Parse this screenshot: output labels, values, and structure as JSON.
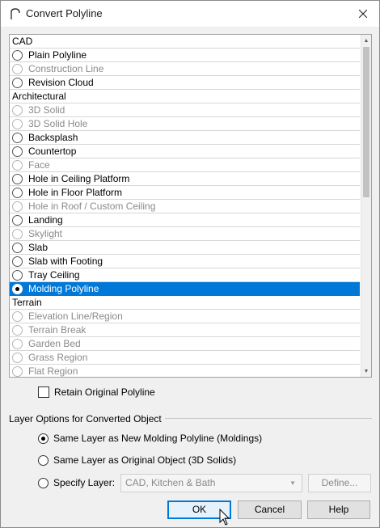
{
  "window": {
    "title": "Convert Polyline"
  },
  "list": {
    "rows": [
      {
        "type": "header",
        "label": "CAD"
      },
      {
        "type": "item",
        "label": "Plain Polyline",
        "enabled": true,
        "selected": false
      },
      {
        "type": "item",
        "label": "Construction Line",
        "enabled": false,
        "selected": false
      },
      {
        "type": "item",
        "label": "Revision Cloud",
        "enabled": true,
        "selected": false
      },
      {
        "type": "header",
        "label": "Architectural"
      },
      {
        "type": "item",
        "label": "3D Solid",
        "enabled": false,
        "selected": false
      },
      {
        "type": "item",
        "label": "3D Solid Hole",
        "enabled": false,
        "selected": false
      },
      {
        "type": "item",
        "label": "Backsplash",
        "enabled": true,
        "selected": false
      },
      {
        "type": "item",
        "label": "Countertop",
        "enabled": true,
        "selected": false
      },
      {
        "type": "item",
        "label": "Face",
        "enabled": false,
        "selected": false
      },
      {
        "type": "item",
        "label": "Hole in Ceiling Platform",
        "enabled": true,
        "selected": false
      },
      {
        "type": "item",
        "label": "Hole in Floor Platform",
        "enabled": true,
        "selected": false
      },
      {
        "type": "item",
        "label": "Hole in Roof / Custom Ceiling",
        "enabled": false,
        "selected": false
      },
      {
        "type": "item",
        "label": "Landing",
        "enabled": true,
        "selected": false
      },
      {
        "type": "item",
        "label": "Skylight",
        "enabled": false,
        "selected": false
      },
      {
        "type": "item",
        "label": "Slab",
        "enabled": true,
        "selected": false
      },
      {
        "type": "item",
        "label": "Slab with Footing",
        "enabled": true,
        "selected": false
      },
      {
        "type": "item",
        "label": "Tray Ceiling",
        "enabled": true,
        "selected": false
      },
      {
        "type": "item",
        "label": "Molding Polyline",
        "enabled": true,
        "selected": true
      },
      {
        "type": "header",
        "label": "Terrain"
      },
      {
        "type": "item",
        "label": "Elevation Line/Region",
        "enabled": false,
        "selected": false
      },
      {
        "type": "item",
        "label": "Terrain Break",
        "enabled": false,
        "selected": false
      },
      {
        "type": "item",
        "label": "Garden Bed",
        "enabled": false,
        "selected": false
      },
      {
        "type": "item",
        "label": "Grass Region",
        "enabled": false,
        "selected": false
      },
      {
        "type": "item",
        "label": "Flat Region",
        "enabled": false,
        "selected": false
      }
    ]
  },
  "retain": {
    "label": "Retain Original Polyline",
    "checked": false
  },
  "layer_options": {
    "title": "Layer Options for Converted Object",
    "option_same_new": "Same Layer as New Molding Polyline (Moldings)",
    "option_same_original": "Same Layer as Original Object (3D Solids)",
    "option_specify": "Specify Layer:",
    "selected": "same_new",
    "layer_value": "CAD, Kitchen & Bath",
    "define_label": "Define..."
  },
  "buttons": {
    "ok": "OK",
    "cancel": "Cancel",
    "help": "Help"
  },
  "colors": {
    "selection": "#0078d7",
    "disabled_text": "#8a8a8a"
  }
}
